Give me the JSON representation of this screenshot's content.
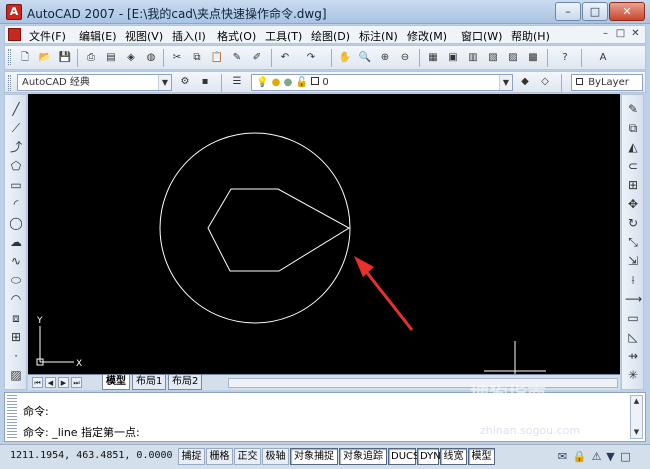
{
  "window": {
    "title": "AutoCAD 2007 - [E:\\我的cad\\夹点快速操作命令.dwg]",
    "minimize": "–",
    "maximize": "□",
    "close": "✕"
  },
  "menubar": {
    "items": [
      "文件(F)",
      "编辑(E)",
      "视图(V)",
      "插入(I)",
      "格式(O)",
      "工具(T)",
      "绘图(D)",
      "标注(N)",
      "修改(M)",
      "窗口(W)",
      "帮助(H)"
    ],
    "right_buttons": [
      "–",
      "□",
      "✕"
    ]
  },
  "toolbar2": {
    "workspace": "AutoCAD 经典",
    "layer_value": "0",
    "color_value": "ByLayer"
  },
  "layout_tabs": {
    "tabs": [
      "模型",
      "布局1",
      "布局2"
    ],
    "active": "模型"
  },
  "canvas": {
    "ucs_y_label": "Y",
    "ucs_x_label": "X"
  },
  "command": {
    "line1": "命令:",
    "line2": "命令: _line 指定第一点:"
  },
  "status": {
    "coords": "1211.1954, 463.4851, 0.0000",
    "buttons": [
      "捕捉",
      "栅格",
      "正交",
      "极轴",
      "对象捕捉",
      "对象追踪",
      "DUCS",
      "DYN",
      "线宽",
      "模型"
    ],
    "on_buttons": [
      "对象捕捉",
      "对象追踪",
      "DUCS",
      "DYN",
      "线宽",
      "模型"
    ]
  },
  "watermark": {
    "text": "搜狗指南",
    "url": "zhinan.sogou.com"
  },
  "colors": {
    "canvas_bg": "#000000",
    "geometry": "#ffffff",
    "arrow": "#e8312a"
  }
}
